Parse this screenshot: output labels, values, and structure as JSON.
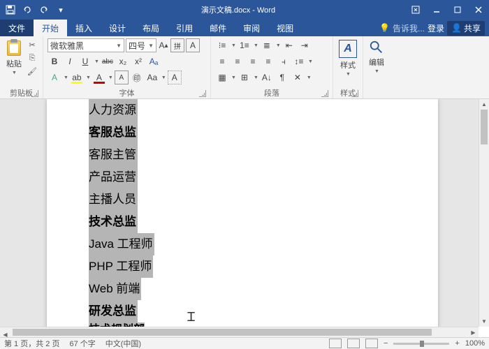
{
  "title": "演示文稿.docx - Word",
  "tabs": {
    "file": "文件",
    "home": "开始",
    "insert": "插入",
    "design": "设计",
    "layout": "布局",
    "references": "引用",
    "mailings": "邮件",
    "review": "审阅",
    "view": "视图",
    "tell": "告诉我...",
    "signin": "登录",
    "share": "共享"
  },
  "ribbon": {
    "clipboard": {
      "label": "剪贴板",
      "paste": "粘贴"
    },
    "font": {
      "label": "字体",
      "name": "微软雅黑",
      "size": "四号",
      "ruby": "拼",
      "btns": {
        "bold": "B",
        "italic": "I",
        "underline": "U",
        "strike": "abc",
        "sub": "x₂",
        "sup": "x²",
        "clear": "A"
      }
    },
    "paragraph": {
      "label": "段落"
    },
    "styles": {
      "label": "样式",
      "btn": "样式"
    },
    "editing": {
      "btn": "编辑"
    }
  },
  "document": {
    "lines": [
      {
        "text": "人力资源",
        "bold": false
      },
      {
        "text": "客服总监",
        "bold": true
      },
      {
        "text": "客服主管",
        "bold": false
      },
      {
        "text": "产品运营",
        "bold": false
      },
      {
        "text": "主播人员",
        "bold": false
      },
      {
        "text": "技术总监",
        "bold": true
      },
      {
        "text": "Java 工程师",
        "bold": false
      },
      {
        "text": "PHP 工程师",
        "bold": false
      },
      {
        "text": "Web 前端",
        "bold": false
      },
      {
        "text": "研发总监",
        "bold": true
      }
    ],
    "cutoff": "技术规划部"
  },
  "status": {
    "page": "第 1 页，共 2 页",
    "words": "67 个字",
    "lang": "中文(中国)",
    "zoom": "100%"
  }
}
